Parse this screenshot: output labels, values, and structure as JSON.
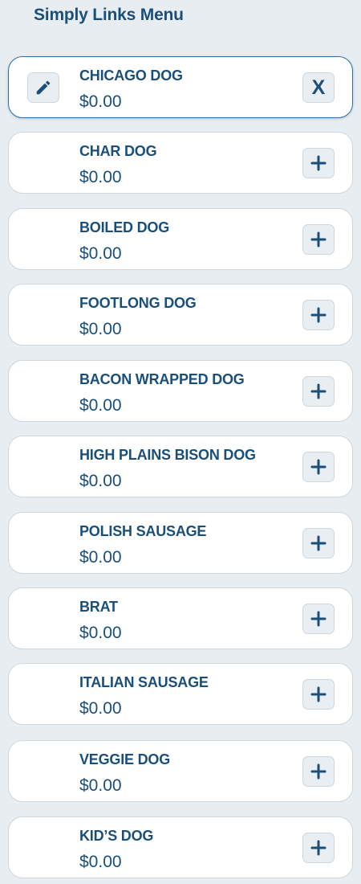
{
  "header": {
    "title": "Simply Links Menu"
  },
  "items": [
    {
      "name": "CHICAGO DOG",
      "price": "$0.00",
      "selected": true,
      "action_label": "X"
    },
    {
      "name": "CHAR DOG",
      "price": "$0.00"
    },
    {
      "name": "BOILED DOG",
      "price": "$0.00"
    },
    {
      "name": "FOOTLONG DOG",
      "price": "$0.00"
    },
    {
      "name": "BACON WRAPPED DOG",
      "price": "$0.00"
    },
    {
      "name": "HIGH PLAINS BISON DOG",
      "price": "$0.00"
    },
    {
      "name": "POLISH SAUSAGE",
      "price": "$0.00"
    },
    {
      "name": "BRAT",
      "price": "$0.00"
    },
    {
      "name": "ITALIAN SAUSAGE",
      "price": "$0.00"
    },
    {
      "name": "VEGGIE DOG",
      "price": "$0.00"
    },
    {
      "name": "KID’S DOG",
      "price": "$0.00"
    }
  ],
  "icons": {
    "edit": "pencil-icon",
    "add": "plus-icon",
    "remove": "close-icon"
  },
  "colors": {
    "accent": "#1a4f7a",
    "background": "#e8edf1",
    "selected_border": "#2b6fa6"
  }
}
